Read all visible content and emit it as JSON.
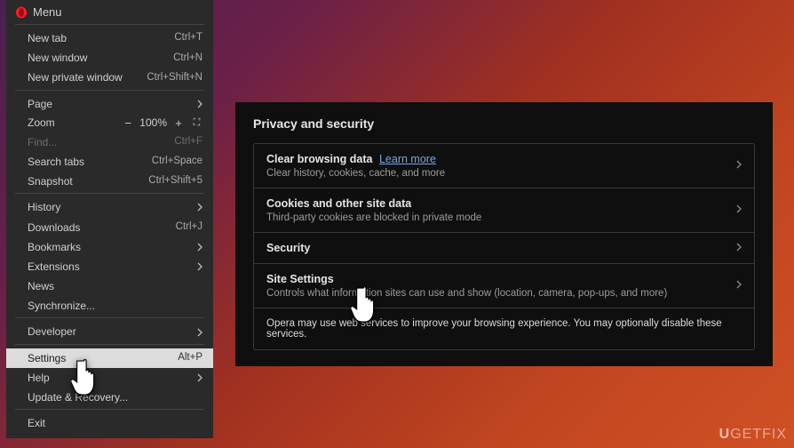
{
  "menu": {
    "title": "Menu",
    "items": {
      "new_tab": {
        "label": "New tab",
        "shortcut": "Ctrl+T"
      },
      "new_window": {
        "label": "New window",
        "shortcut": "Ctrl+N"
      },
      "new_private": {
        "label": "New private window",
        "shortcut": "Ctrl+Shift+N"
      },
      "page": {
        "label": "Page"
      },
      "zoom": {
        "label": "Zoom",
        "level": "100%"
      },
      "find": {
        "label": "Find...",
        "shortcut": "Ctrl+F"
      },
      "search_tabs": {
        "label": "Search tabs",
        "shortcut": "Ctrl+Space"
      },
      "snapshot": {
        "label": "Snapshot",
        "shortcut": "Ctrl+Shift+5"
      },
      "history": {
        "label": "History"
      },
      "downloads": {
        "label": "Downloads",
        "shortcut": "Ctrl+J"
      },
      "bookmarks": {
        "label": "Bookmarks"
      },
      "extensions": {
        "label": "Extensions"
      },
      "news": {
        "label": "News"
      },
      "synchronize": {
        "label": "Synchronize..."
      },
      "developer": {
        "label": "Developer"
      },
      "settings": {
        "label": "Settings",
        "shortcut": "Alt+P"
      },
      "help": {
        "label": "Help"
      },
      "update": {
        "label": "Update & Recovery..."
      },
      "exit": {
        "label": "Exit"
      }
    },
    "zoom_controls": {
      "minus": "−",
      "plus": "+",
      "fullscreen": "⛶"
    }
  },
  "settings": {
    "title": "Privacy and security",
    "learn_more": "Learn more",
    "rows": {
      "clear": {
        "title": "Clear browsing data",
        "sub": "Clear history, cookies, cache, and more"
      },
      "cookies": {
        "title": "Cookies and other site data",
        "sub": "Third-party cookies are blocked in private mode"
      },
      "security": {
        "title": "Security"
      },
      "site": {
        "title": "Site Settings",
        "sub": "Controls what information sites can use and show (location, camera, pop-ups, and more)"
      },
      "notice": {
        "text": "Opera may use web services to improve your browsing experience. You may optionally disable these services."
      }
    }
  },
  "watermark": {
    "prefix": "U",
    "suffix": "GETFIX"
  }
}
